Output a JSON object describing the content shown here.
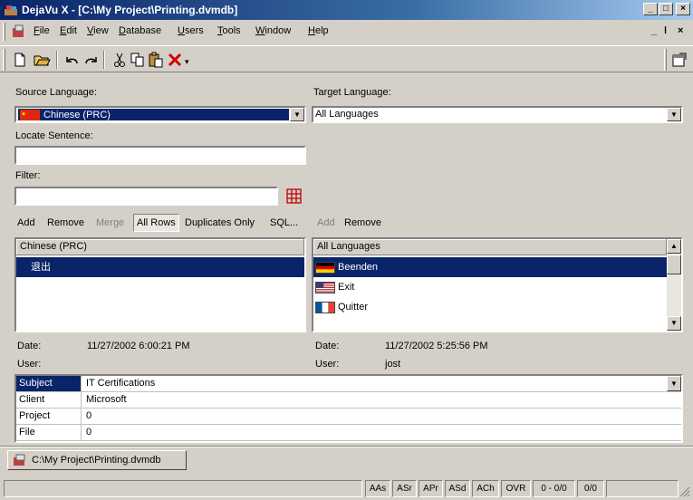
{
  "window": {
    "title": "DejaVu X - [C:\\My Project\\Printing.dvmdb]",
    "controls": [
      "_",
      "□",
      "×"
    ],
    "mdi_controls": [
      "_",
      "ǀ",
      "×"
    ]
  },
  "menu": {
    "items": [
      {
        "accel": "F",
        "rest": "ile"
      },
      {
        "accel": "E",
        "rest": "dit"
      },
      {
        "accel": "V",
        "rest": "iew"
      },
      {
        "accel": "D",
        "rest": "atabase"
      },
      {
        "accel": "U",
        "rest": "sers"
      },
      {
        "accel": "T",
        "rest": "ools"
      },
      {
        "accel": "W",
        "rest": "indow"
      },
      {
        "accel": "H",
        "rest": "elp"
      }
    ]
  },
  "toolbar": {
    "icons": [
      "new-icon",
      "open-icon",
      "undo-icon",
      "redo-icon",
      "cut-icon",
      "copy-icon",
      "paste-icon",
      "delete-icon",
      "properties-icon"
    ]
  },
  "source": {
    "label": "Source Language:",
    "value": "Chinese (PRC)",
    "locate_label": "Locate Sentence:",
    "locate_value": "",
    "filter_label": "Filter:",
    "filter_value": ""
  },
  "target": {
    "label": "Target Language:",
    "value": "All Languages"
  },
  "left_actions": [
    "Add",
    "Remove",
    "Merge",
    "All Rows",
    "Duplicates Only",
    "SQL..."
  ],
  "right_actions": [
    "Add",
    "Remove"
  ],
  "left_list": {
    "header": "Chinese (PRC)",
    "rows": [
      "退出"
    ]
  },
  "right_list": {
    "header": "All Languages",
    "rows": [
      {
        "text": "Beenden",
        "flag": "de"
      },
      {
        "text": "Exit",
        "flag": "us"
      },
      {
        "text": "Quitter",
        "flag": "fr"
      }
    ]
  },
  "left_info": {
    "date_label": "Date:",
    "date_value": "11/27/2002 6:00:21 PM",
    "user_label": "User:",
    "user_value": ""
  },
  "right_info": {
    "date_label": "Date:",
    "date_value": "11/27/2002 5:25:56 PM",
    "user_label": "User:",
    "user_value": "jost"
  },
  "attributes": [
    {
      "key": "Subject",
      "value": "IT Certifications"
    },
    {
      "key": "Client",
      "value": "Microsoft"
    },
    {
      "key": "Project",
      "value": "0"
    },
    {
      "key": "File",
      "value": "0"
    }
  ],
  "doc_tab": "C:\\My Project\\Printing.dvmdb",
  "status": {
    "panels": [
      "AAs",
      "ASr",
      "APr",
      "ASd",
      "ACh",
      "OVR",
      "0 - 0/0",
      "0/0"
    ]
  },
  "colors": {
    "selection": "#0a246a",
    "titlebar_start": "#0a246a",
    "titlebar_end": "#a6caf0"
  }
}
